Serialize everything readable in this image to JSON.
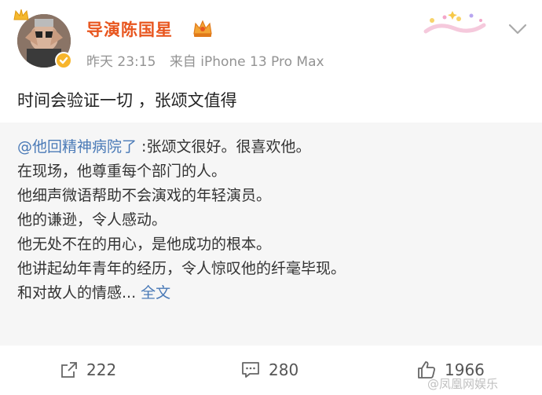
{
  "author": {
    "name": "导演陈国星",
    "timestamp": "昨天 23:15",
    "source": "来自 iPhone 13 Pro Max",
    "badge_icon": "verified-badge-icon",
    "vip_icon": "crown-icon"
  },
  "post": {
    "text": "时间会验证一切 ，张颂文值得"
  },
  "repost": {
    "mention": "@他回精神病院了",
    "first_line_rest": " :张颂文很好。很喜欢他。",
    "lines": [
      "在现场，他尊重每个部门的人。",
      "他细声微语帮助不会演戏的年轻演员。",
      "他的谦逊，令人感动。",
      "他无处不在的用心，是他成功的根本。",
      "他讲起幼年青年的经历，令人惊叹他的纤毫毕现。"
    ],
    "last_line": "和对故人的情感... ",
    "full_text_link": "全文"
  },
  "actions": {
    "repost_count": "222",
    "comment_count": "280",
    "like_count": "1966"
  },
  "watermark": "@凤凰网娱乐",
  "colors": {
    "username": "#e8561f",
    "link": "#4a7ab7",
    "meta": "#939393",
    "repost_bg": "#f6f6f6"
  }
}
